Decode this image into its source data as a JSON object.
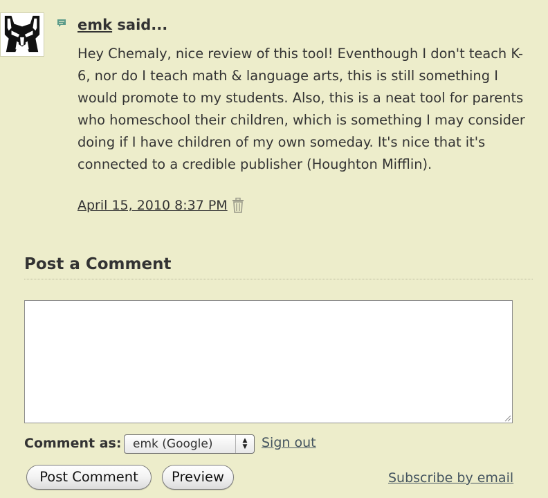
{
  "comment": {
    "author": "emk",
    "said_suffix": " said...",
    "body": "Hey Chemaly, nice review of this tool! Eventhough I don't teach K-6, nor do I teach math & language arts, this is still something I would promote to my students. Also, this is a neat tool for parents who homeschool their children, which is something I may consider doing if I have children of my own someday. It's nice that it's connected to a credible publisher (Houghton Mifflin).",
    "timestamp": "April 15, 2010 8:37 PM",
    "avatar_icon": "transformers-autobot-icon",
    "comment_icon": "speech-bubble-icon",
    "delete_icon": "trash-icon"
  },
  "post_comment": {
    "title": "Post a Comment",
    "textarea_value": "",
    "comment_as_label": "Comment as:",
    "identity_selected": "emk (Google)",
    "sign_out_label": "Sign out",
    "post_button_label": "Post Comment",
    "preview_button_label": "Preview",
    "subscribe_label": "Subscribe by email"
  },
  "colors": {
    "background": "#ededcb",
    "text": "#333333",
    "link": "#44545f",
    "comment_icon": "#5b9b8a"
  }
}
